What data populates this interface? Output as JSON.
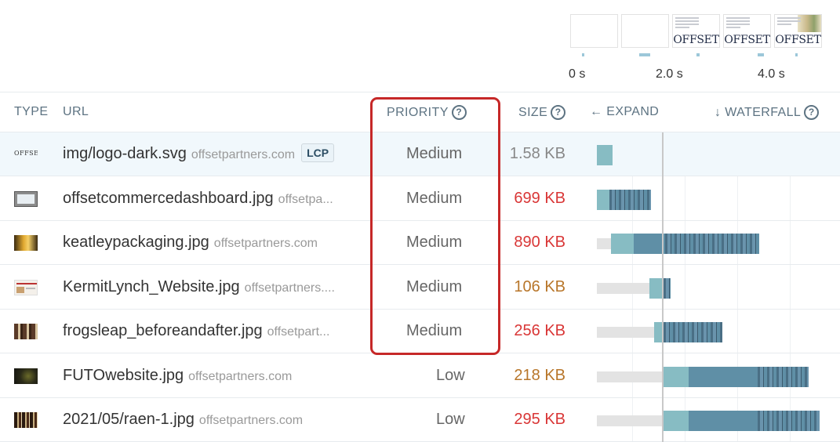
{
  "filmstrip": {
    "frames": [
      {
        "logo": ""
      },
      {
        "logo": ""
      },
      {
        "logo": "OFFSET"
      },
      {
        "logo": "OFFSET"
      },
      {
        "logo": "OFFSET"
      }
    ],
    "time_labels": [
      "0 s",
      "2.0 s",
      "4.0 s"
    ]
  },
  "table": {
    "headers": {
      "type": "TYPE",
      "url": "URL",
      "priority": "PRIORITY",
      "size": "SIZE",
      "expand": "← EXPAND",
      "waterfall": "↓ WATERFALL"
    },
    "rows": [
      {
        "path": "img/logo-dark.svg",
        "domain": "offsetpartners.com",
        "badge": "LCP",
        "priority": "Medium",
        "size": "1.58 KB",
        "size_color": "#888888",
        "thumb": "logo"
      },
      {
        "path": "offsetcommercedashboard.jpg",
        "domain": "offsetpa...",
        "badge": "",
        "priority": "Medium",
        "size": "699 KB",
        "size_color": "#d93636",
        "thumb": "screen"
      },
      {
        "path": "keatleypackaging.jpg",
        "domain": "offsetpartners.com",
        "badge": "",
        "priority": "Medium",
        "size": "890 KB",
        "size_color": "#d93636",
        "thumb": "amber"
      },
      {
        "path": "KermitLynch_Website.jpg",
        "domain": "offsetpartners....",
        "badge": "",
        "priority": "Medium",
        "size": "106 KB",
        "size_color": "#b8762a",
        "thumb": "web"
      },
      {
        "path": "frogsleap_beforeandafter.jpg",
        "domain": "offsetpart...",
        "badge": "",
        "priority": "Medium",
        "size": "256 KB",
        "size_color": "#d93636",
        "thumb": "bottles"
      },
      {
        "path": "FUTOwebsite.jpg",
        "domain": "offsetpartners.com",
        "badge": "",
        "priority": "Low",
        "size": "218 KB",
        "size_color": "#b8762a",
        "thumb": "dark"
      },
      {
        "path": "2021/05/raen-1.jpg",
        "domain": "offsetpartners.com",
        "badge": "",
        "priority": "Low",
        "size": "295 KB",
        "size_color": "#d93636",
        "thumb": "bottles2"
      }
    ]
  },
  "colors": {
    "accent_highlight": "#c62828",
    "header_text": "#5d7382",
    "red_size": "#d93636",
    "amber_size": "#b8762a"
  }
}
